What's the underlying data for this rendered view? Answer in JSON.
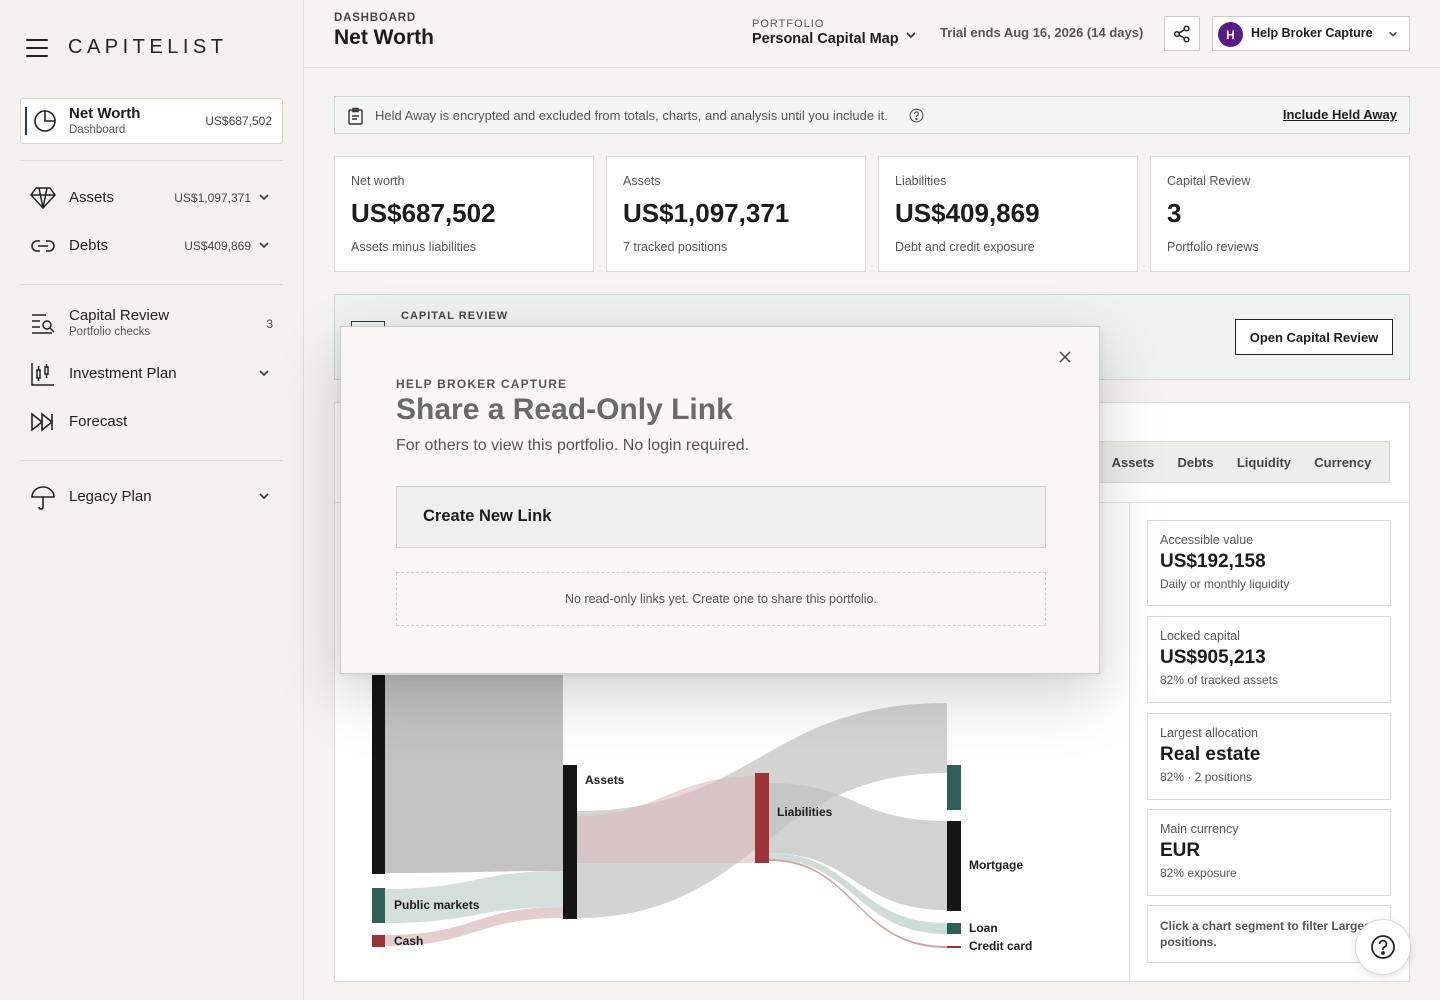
{
  "brand": {
    "logo": "CAPITELIST"
  },
  "sidebar": {
    "active": {
      "label": "Net Worth",
      "sub": "Dashboard",
      "value": "US$687,502"
    },
    "items": [
      {
        "label": "Assets",
        "amount": "US$1,097,371"
      },
      {
        "label": "Debts",
        "amount": "US$409,869"
      },
      {
        "label": "Capital Review",
        "sub": "Portfolio checks",
        "count": "3"
      },
      {
        "label": "Investment Plan"
      },
      {
        "label": "Forecast"
      },
      {
        "label": "Legacy Plan"
      }
    ]
  },
  "header": {
    "eyebrow": "DASHBOARD",
    "title": "Net Worth",
    "portfolio_eyebrow": "PORTFOLIO",
    "portfolio_name": "Personal Capital Map",
    "trial": "Trial ends Aug 16, 2026 (14 days)",
    "user_initial": "H",
    "user_name": "Help Broker Capture"
  },
  "notice": {
    "text": "Held Away is encrypted and excluded from totals, charts, and analysis until you include it.",
    "link": "Include Held Away"
  },
  "stats": [
    {
      "label": "Net worth",
      "value": "US$687,502",
      "sub": "Assets minus liabilities"
    },
    {
      "label": "Assets",
      "value": "US$1,097,371",
      "sub": "7 tracked positions"
    },
    {
      "label": "Liabilities",
      "value": "US$409,869",
      "sub": "Debt and credit exposure"
    },
    {
      "label": "Capital Review",
      "value": "3",
      "sub": "Portfolio reviews"
    }
  ],
  "review_banner": {
    "eyebrow": "CAPITAL REVIEW",
    "button": "Open Capital Review"
  },
  "tabs": [
    "Assets",
    "Debts",
    "Liquidity",
    "Currency"
  ],
  "sankey_labels": {
    "public_markets": "Public markets",
    "cash": "Cash",
    "assets": "Assets",
    "liabilities": "Liabilities",
    "mortgage": "Mortgage",
    "loan": "Loan",
    "credit_card": "Credit card"
  },
  "side_cards": [
    {
      "label": "Accessible value",
      "value": "US$192,158",
      "sub": "Daily or monthly liquidity"
    },
    {
      "label": "Locked capital",
      "value": "US$905,213",
      "sub": "82% of tracked assets"
    },
    {
      "label": "Largest allocation",
      "value": "Real estate",
      "sub": "82% · 2 positions"
    },
    {
      "label": "Main currency",
      "value": "EUR",
      "sub": "82% exposure"
    }
  ],
  "side_note": "Click a chart segment to filter Largest positions.",
  "modal": {
    "eyebrow": "HELP BROKER CAPTURE",
    "title": "Share a Read-Only Link",
    "description": "For others to view this portfolio. No login required.",
    "create_button": "Create New Link",
    "empty_state": "No read-only links yet. Create one to share this portfolio."
  },
  "colors": {
    "accent": "#1f3f3a",
    "teal": "#2e5f59",
    "red": "#9e3236",
    "avatar": "#5a1a86"
  }
}
